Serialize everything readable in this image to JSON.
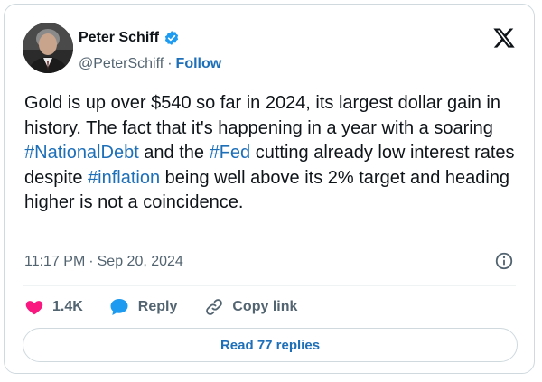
{
  "author": {
    "name": "Peter Schiff",
    "handle": "@PeterSchiff",
    "separator": "·",
    "follow_label": "Follow",
    "verified": true
  },
  "tweet": {
    "segments": [
      {
        "text": "Gold is up over $540 so far in 2024, its largest dollar gain in history. The fact that it's happening in a year with a soaring ",
        "type": "text"
      },
      {
        "text": "#NationalDebt",
        "type": "hashtag"
      },
      {
        "text": " and the ",
        "type": "text"
      },
      {
        "text": "#Fed",
        "type": "hashtag"
      },
      {
        "text": " cutting already low interest rates despite ",
        "type": "text"
      },
      {
        "text": "#inflation",
        "type": "hashtag"
      },
      {
        "text": " being well above its 2% target and heading higher is not a coincidence.",
        "type": "text"
      }
    ],
    "time": "11:17 PM",
    "meta_separator": "·",
    "date": "Sep 20, 2024"
  },
  "actions": {
    "likes": "1.4K",
    "reply_label": "Reply",
    "copy_link_label": "Copy link"
  },
  "read_replies_label": "Read 77 replies",
  "colors": {
    "link": "#1d6fb8",
    "heart": "#f91880",
    "reply_bubble": "#1d9bf0",
    "verified": "#1d9bf0"
  },
  "icons": [
    "verified-badge-icon",
    "x-logo-icon",
    "info-icon",
    "heart-icon",
    "reply-icon",
    "link-icon"
  ]
}
